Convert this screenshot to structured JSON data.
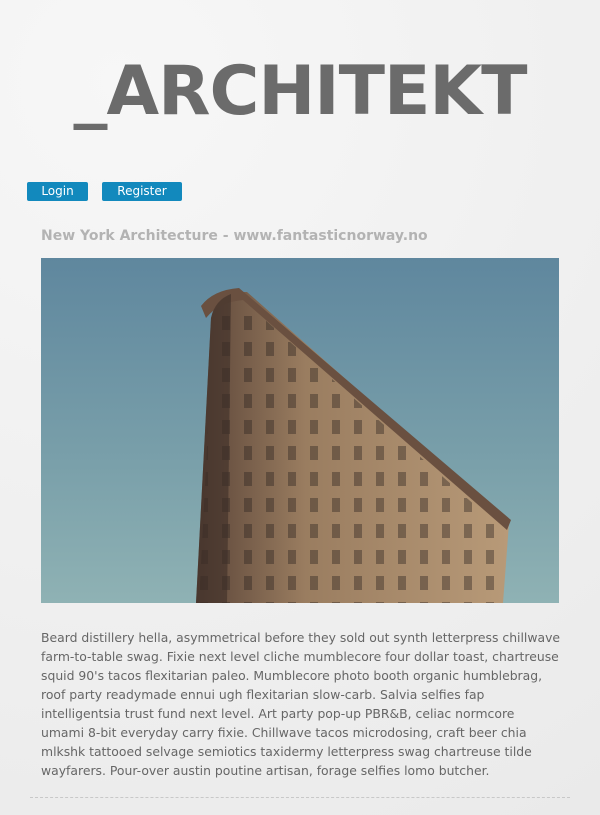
{
  "site": {
    "logo": "_ARCHITEKT"
  },
  "auth": {
    "login_label": "Login",
    "register_label": "Register"
  },
  "post": {
    "title": "New York Architecture - www.fantasticnorway.no",
    "body": "Beard distillery hella, asymmetrical before they sold out synth letterpress chillwave farm-to-table swag. Fixie next level cliche mumblecore four dollar toast, chartreuse squid 90's tacos flexitarian paleo. Mumblecore photo booth organic humblebrag, roof party readymade ennui ugh flexitarian slow-carb. Salvia selfies fap intelligentsia trust fund next level. Art party pop-up PBR&B, celiac normcore umami 8-bit everyday carry fixie. Chillwave tacos microdosing, craft beer chia mlkshk tattooed selvage semiotics taxidermy letterpress swag chartreuse tilde wayfarers. Pour-over austin poutine artisan, forage selfies lomo butcher."
  },
  "colors": {
    "accent": "#1289bd",
    "logo": "#6b6b6b",
    "title": "#b3b3b3",
    "text": "#666666"
  }
}
